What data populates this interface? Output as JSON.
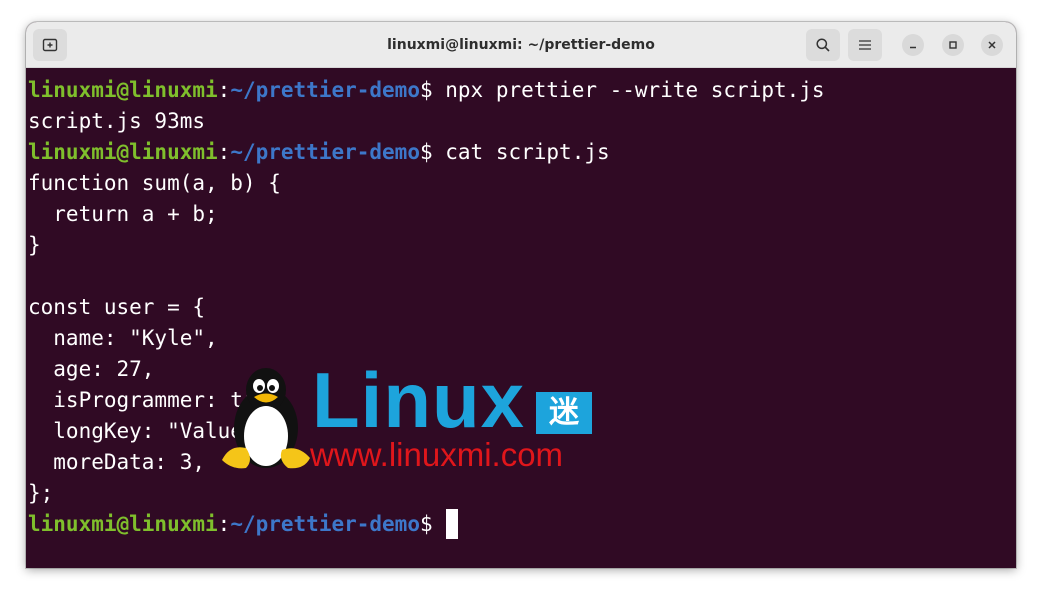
{
  "window": {
    "title": "linuxmi@linuxmi: ~/prettier-demo"
  },
  "icons": {
    "new_tab": "new-tab-icon",
    "search": "search-icon",
    "menu": "hamburger-menu-icon",
    "minimize": "minimize-icon",
    "maximize": "maximize-icon",
    "close": "close-icon"
  },
  "prompt": {
    "user": "linuxmi@linuxmi",
    "separator": ":",
    "path": "~/prettier-demo",
    "symbol": "$"
  },
  "terminal": {
    "cmd1": " npx prettier --write script.js",
    "out1": "script.js 93ms",
    "cmd2": " cat script.js",
    "code": [
      "function sum(a, b) {",
      "  return a + b;",
      "}",
      "",
      "const user = {",
      "  name: \"Kyle\",",
      "  age: 27,",
      "  isProgrammer: true,",
      "  longKey: \"Value\",",
      "  moreData: 3,",
      "};"
    ],
    "cmd3": " "
  },
  "watermark": {
    "brand": "Linux",
    "brand_char": "迷",
    "url": "www.linuxmi.com"
  },
  "colors": {
    "terminal_bg": "#300a24",
    "prompt_user": "#7fbf2c",
    "prompt_path": "#3d77c9",
    "brand_blue": "#1da4dc",
    "brand_red": "#e0161b"
  }
}
